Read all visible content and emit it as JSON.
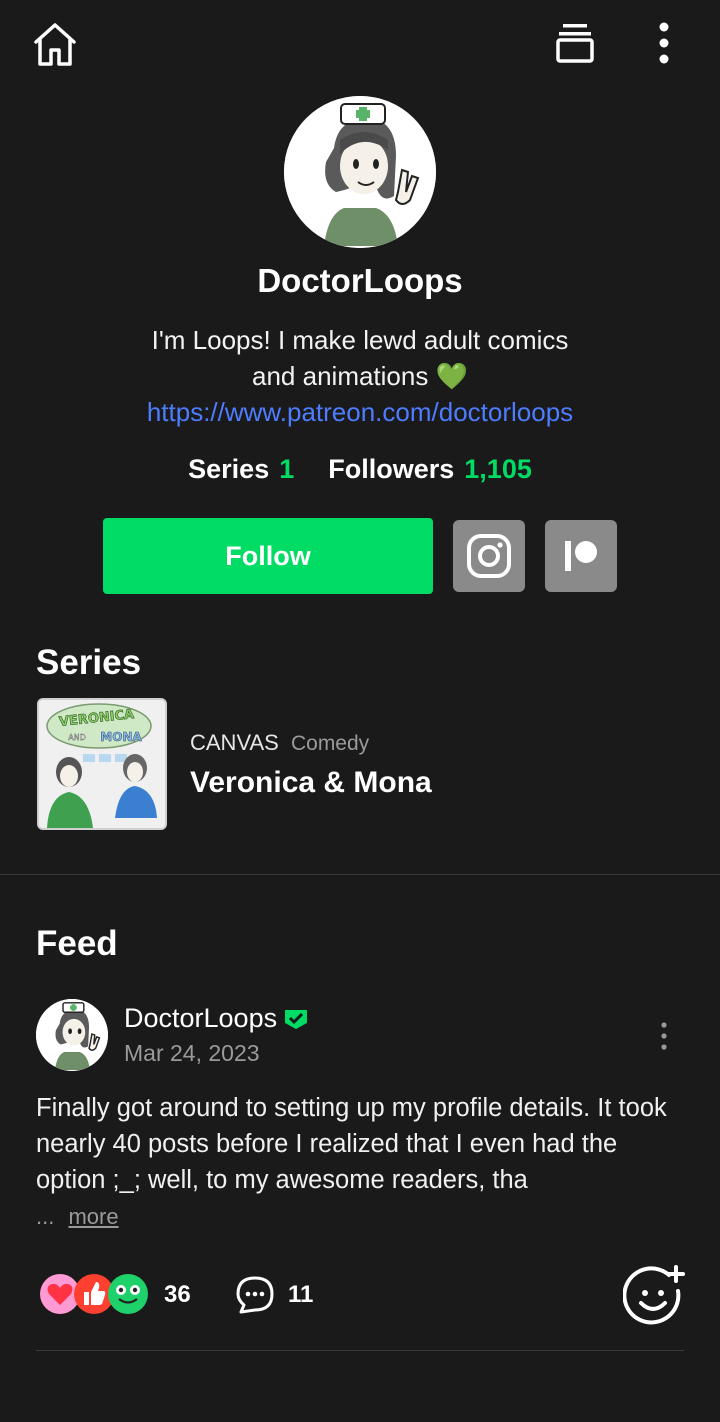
{
  "colors": {
    "background": "#1a1a1a",
    "accent": "#00dc64",
    "link": "#4d7cff",
    "icon_button": "#8a8a8a"
  },
  "topbar": {
    "home_icon": "home-icon",
    "library_icon": "library-icon",
    "more_icon": "more-vertical-icon"
  },
  "profile": {
    "name": "DoctorLoops",
    "bio_line1": "I'm Loops! I make lewd adult comics",
    "bio_line2": "and animations",
    "bio_emoji": "💚",
    "link": "https://www.patreon.com/doctorloops",
    "series_label": "Series",
    "series_count": "1",
    "followers_label": "Followers",
    "followers_count": "1,105",
    "follow_label": "Follow",
    "social": [
      "instagram-icon",
      "patreon-icon"
    ]
  },
  "series_section": {
    "title": "Series",
    "items": [
      {
        "platform": "CANVAS",
        "genre": "Comedy",
        "title": "Veronica & Mona",
        "thumb_title_top": "VERONICA",
        "thumb_title_and": "AND",
        "thumb_title_bottom": "MONA"
      }
    ]
  },
  "feed": {
    "title": "Feed",
    "posts": [
      {
        "author": "DoctorLoops",
        "date": "Mar 24, 2023",
        "text": "Finally got around to setting up my profile details. It took nearly 40 posts before I realized that I even had the option ;_; well, to my awesome readers, tha",
        "ellipsis": "...",
        "more_label": "more",
        "reaction_count": "36",
        "comment_count": "11"
      }
    ]
  }
}
